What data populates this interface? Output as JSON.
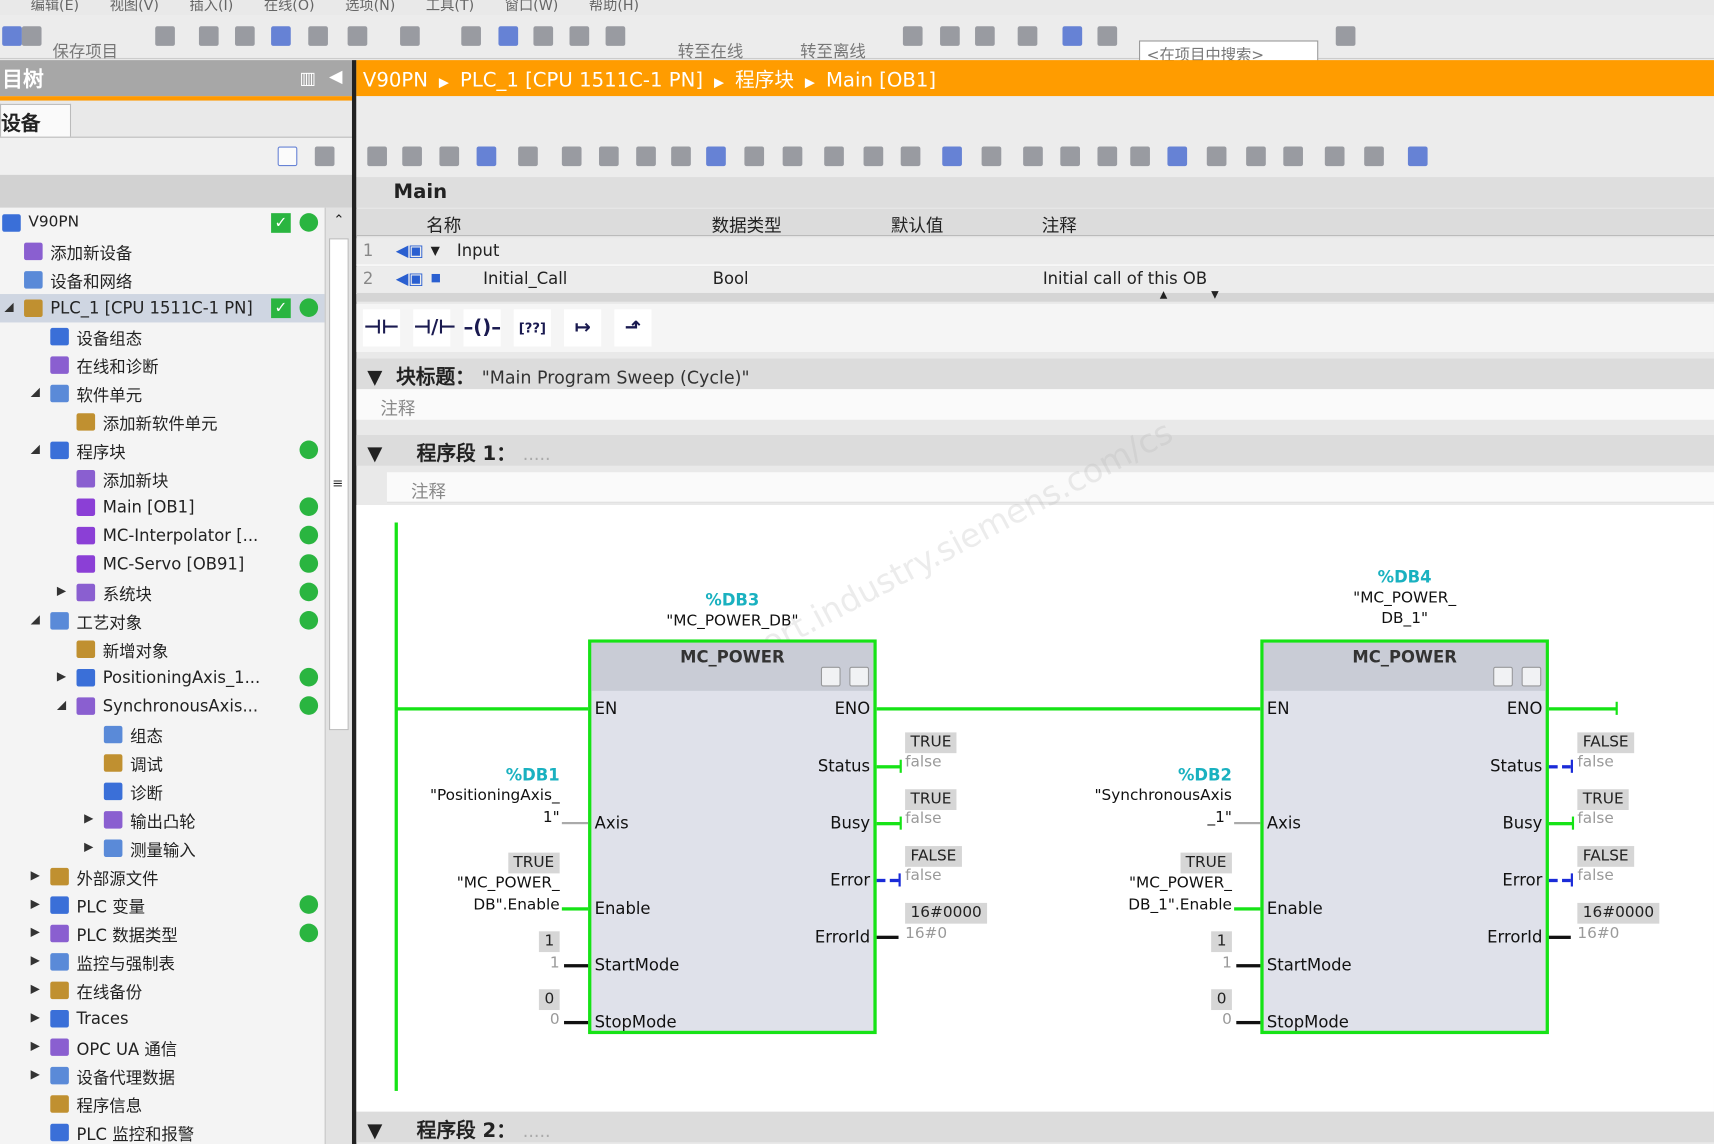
{
  "menu": [
    "编辑(E)",
    "视图(V)",
    "插入(I)",
    "在线(O)",
    "选项(N)",
    "工具(T)",
    "窗口(W)",
    "帮助(H)"
  ],
  "toolbar": {
    "save": "保存项目",
    "go_online": "转至在线",
    "go_offline": "转至离线",
    "search_placeholder": "<在项目中搜索>"
  },
  "left": {
    "title": "目树",
    "tab": "设备"
  },
  "tree": [
    {
      "label": "V90PN",
      "level": 0,
      "arrow": "",
      "check": true,
      "dot": true,
      "icon": "project-icon"
    },
    {
      "label": "添加新设备",
      "level": 1,
      "arrow": "",
      "icon": "add-device-icon"
    },
    {
      "label": "设备和网络",
      "level": 1,
      "arrow": "",
      "icon": "network-icon"
    },
    {
      "label": "PLC_1 [CPU 1511C-1 PN]",
      "level": 1,
      "arrow": "down",
      "check": true,
      "dot": true,
      "selected": true,
      "icon": "plc-icon"
    },
    {
      "label": "设备组态",
      "level": 2,
      "arrow": "",
      "icon": "device-config-icon"
    },
    {
      "label": "在线和诊断",
      "level": 2,
      "arrow": "",
      "icon": "diagnostics-icon"
    },
    {
      "label": "软件单元",
      "level": 2,
      "arrow": "down",
      "icon": "software-unit-icon"
    },
    {
      "label": "添加新软件单元",
      "level": 3,
      "arrow": "",
      "icon": "add-icon"
    },
    {
      "label": "程序块",
      "level": 2,
      "arrow": "down",
      "dot": true,
      "icon": "folder-icon"
    },
    {
      "label": "添加新块",
      "level": 3,
      "arrow": "",
      "icon": "add-icon"
    },
    {
      "label": "Main [OB1]",
      "level": 3,
      "arrow": "",
      "dot": true,
      "icon": "ob-block-icon"
    },
    {
      "label": "MC-Interpolator [...",
      "level": 3,
      "arrow": "",
      "dot": true,
      "icon": "ob-block-icon"
    },
    {
      "label": "MC-Servo [OB91]",
      "level": 3,
      "arrow": "",
      "dot": true,
      "icon": "ob-block-icon"
    },
    {
      "label": "系统块",
      "level": 3,
      "arrow": "right",
      "dot": true,
      "icon": "folder-icon"
    },
    {
      "label": "工艺对象",
      "level": 2,
      "arrow": "down",
      "dot": true,
      "icon": "folder-icon"
    },
    {
      "label": "新增对象",
      "level": 3,
      "arrow": "",
      "icon": "add-icon"
    },
    {
      "label": "PositioningAxis_1...",
      "level": 3,
      "arrow": "right",
      "dot": true,
      "icon": "axis-icon"
    },
    {
      "label": "SynchronousAxis...",
      "level": 3,
      "arrow": "down",
      "dot": true,
      "icon": "sync-axis-icon"
    },
    {
      "label": "组态",
      "level": 4,
      "arrow": "",
      "icon": "config-icon"
    },
    {
      "label": "调试",
      "level": 4,
      "arrow": "",
      "icon": "commissioning-icon"
    },
    {
      "label": "诊断",
      "level": 4,
      "arrow": "",
      "icon": "diagnostics-icon"
    },
    {
      "label": "输出凸轮",
      "level": 4,
      "arrow": "right",
      "icon": "folder-icon"
    },
    {
      "label": "测量输入",
      "level": 4,
      "arrow": "right",
      "icon": "folder-icon"
    },
    {
      "label": "外部源文件",
      "level": 2,
      "arrow": "right",
      "icon": "folder-icon"
    },
    {
      "label": "PLC 变量",
      "level": 2,
      "arrow": "right",
      "dot": true,
      "icon": "tags-icon"
    },
    {
      "label": "PLC 数据类型",
      "level": 2,
      "arrow": "right",
      "dot": true,
      "icon": "datatype-icon"
    },
    {
      "label": "监控与强制表",
      "level": 2,
      "arrow": "right",
      "icon": "watch-table-icon"
    },
    {
      "label": "在线备份",
      "level": 2,
      "arrow": "right",
      "icon": "backup-icon"
    },
    {
      "label": "Traces",
      "level": 2,
      "arrow": "right",
      "icon": "traces-icon"
    },
    {
      "label": "OPC UA 通信",
      "level": 2,
      "arrow": "right",
      "icon": "opcua-icon"
    },
    {
      "label": "设备代理数据",
      "level": 2,
      "arrow": "right",
      "icon": "proxy-icon"
    },
    {
      "label": "程序信息",
      "level": 2,
      "arrow": "",
      "icon": "program-info-icon"
    },
    {
      "label": "PLC 监控和报警",
      "level": 2,
      "arrow": "",
      "icon": "alarm-icon"
    }
  ],
  "breadcrumb": [
    "V90PN",
    "PLC_1 [CPU 1511C-1 PN]",
    "程序块",
    "Main [OB1]"
  ],
  "editor": {
    "block_name": "Main",
    "interface": {
      "headers": [
        "名称",
        "数据类型",
        "默认值",
        "注释"
      ],
      "rows": [
        {
          "n": "1",
          "name": "Input",
          "type": "",
          "default": "",
          "comment": ""
        },
        {
          "n": "2",
          "name": "Initial_Call",
          "type": "Bool",
          "default": "",
          "comment": "Initial call of this OB"
        }
      ]
    },
    "block_title_label": "块标题：",
    "block_title": "\"Main Program Sweep (Cycle)\"",
    "comment": "注释",
    "segments": [
      {
        "label": "程序段 1：",
        "value": "....."
      },
      {
        "label": "程序段 2：",
        "value": "....."
      }
    ]
  },
  "blocks": [
    {
      "db": "%DB3",
      "inst": [
        "\"MC_POWER_DB\""
      ],
      "name": "MC_POWER",
      "axis_db": "%DB1",
      "axis": [
        "\"PositioningAxis_",
        "1\""
      ],
      "enable_val": "TRUE",
      "enable": [
        "\"MC_POWER_",
        "DB\".Enable"
      ],
      "start_val": "1",
      "start": "1",
      "stop_val": "0",
      "stop": "0",
      "status_val": "TRUE",
      "status": "false",
      "busy_val": "TRUE",
      "busy": "false",
      "error_val": "FALSE",
      "error": "false",
      "errorid_val": "16#0000",
      "errorid": "16#0",
      "status_true": true,
      "busy_true": true
    },
    {
      "db": "%DB4",
      "inst": [
        "\"MC_POWER_",
        "DB_1\""
      ],
      "name": "MC_POWER",
      "axis_db": "%DB2",
      "axis": [
        "\"SynchronousAxis",
        "_1\""
      ],
      "enable_val": "TRUE",
      "enable": [
        "\"MC_POWER_",
        "DB_1\".Enable"
      ],
      "start_val": "1",
      "start": "1",
      "stop_val": "0",
      "stop": "0",
      "status_val": "FALSE",
      "status": "false",
      "busy_val": "TRUE",
      "busy": "false",
      "error_val": "FALSE",
      "error": "false",
      "errorid_val": "16#0000",
      "errorid": "16#0",
      "status_true": false,
      "busy_true": true
    }
  ],
  "pins": {
    "en": "EN",
    "eno": "ENO",
    "axis": "Axis",
    "enable": "Enable",
    "startmode": "StartMode",
    "stopmode": "StopMode",
    "status": "Status",
    "busy": "Busy",
    "error": "Error",
    "errorid": "ErrorId"
  },
  "colors": {
    "accent": "#ff9c00",
    "power_flow": "#16e316",
    "false_flow": "#1a2bd8",
    "db_label": "#1ab1c0"
  }
}
